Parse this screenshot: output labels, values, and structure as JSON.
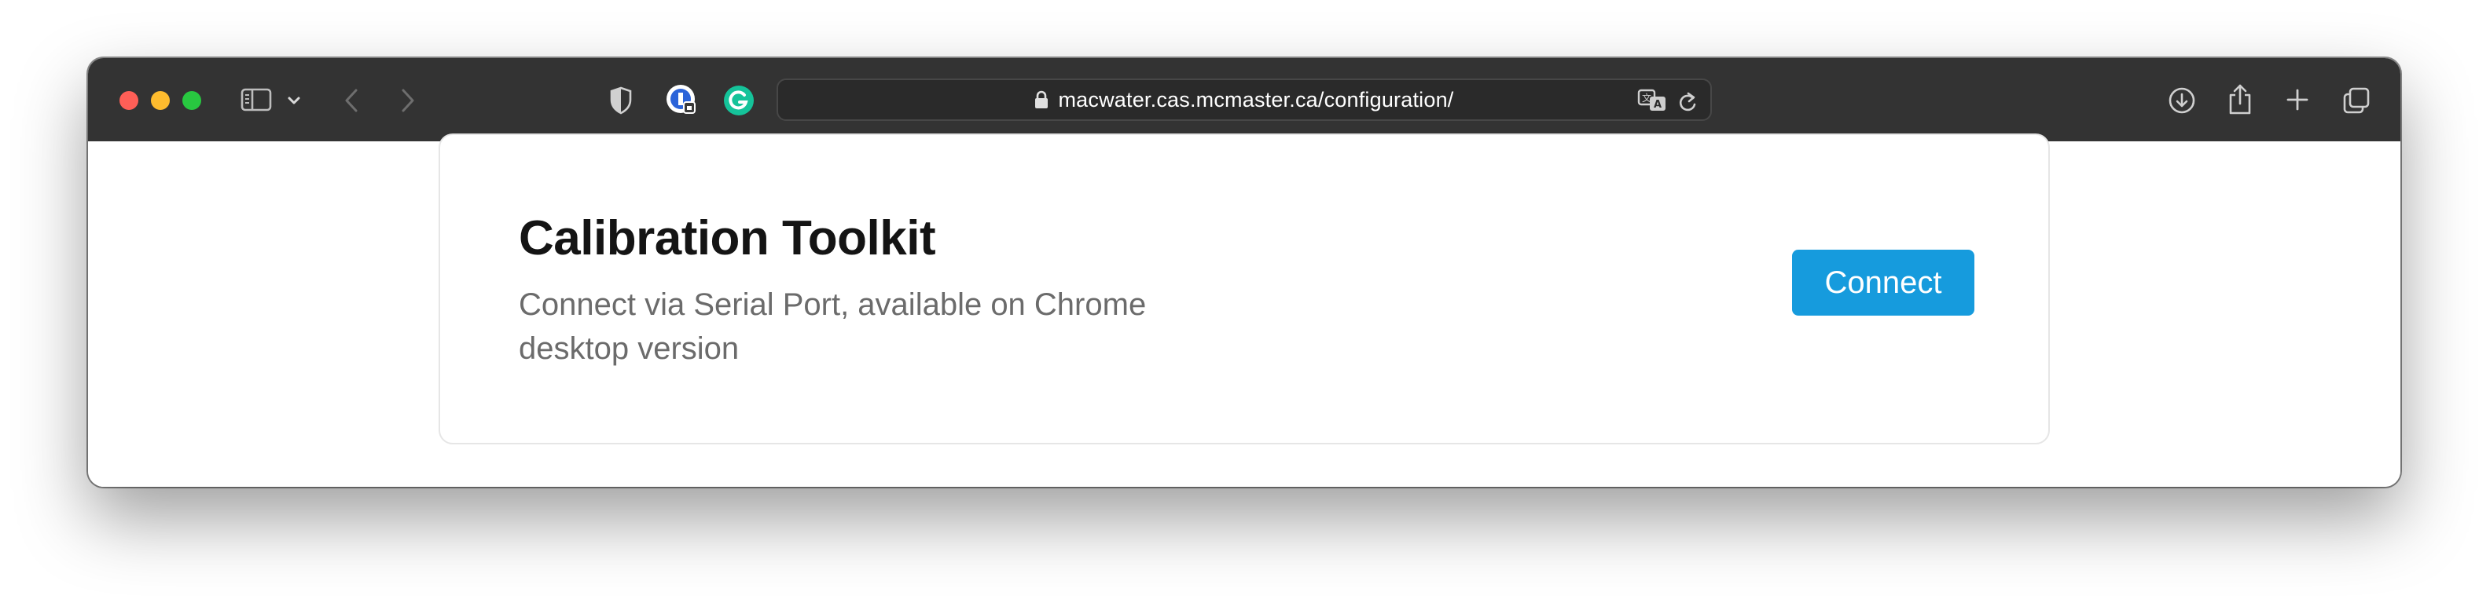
{
  "browser": {
    "url": {
      "host": "macwater.cas.mcmaster.ca",
      "path": "/configuration/"
    },
    "icons": {
      "sidebar": "sidebar-icon",
      "chevron": "chevron-down-icon",
      "back": "back-icon",
      "forward": "forward-icon",
      "shield": "shield-icon",
      "extension1": "password-manager-icon",
      "extension2": "grammarly-icon",
      "lock": "lock-icon",
      "translate": "translate-icon",
      "reload": "reload-icon",
      "download": "download-icon",
      "share": "share-icon",
      "new_tab": "plus-icon",
      "tabs": "tab-overview-icon"
    },
    "colors": {
      "toolbar": "#333333",
      "close": "#ff5f57",
      "minimize": "#febc2e",
      "zoom": "#28c840",
      "grammarly": "#15c39a"
    }
  },
  "page": {
    "title": "Calibration Toolkit",
    "description": "Connect via Serial Port, available on Chrome desktop version",
    "connect_label": "Connect",
    "accent": "#169bdd"
  }
}
